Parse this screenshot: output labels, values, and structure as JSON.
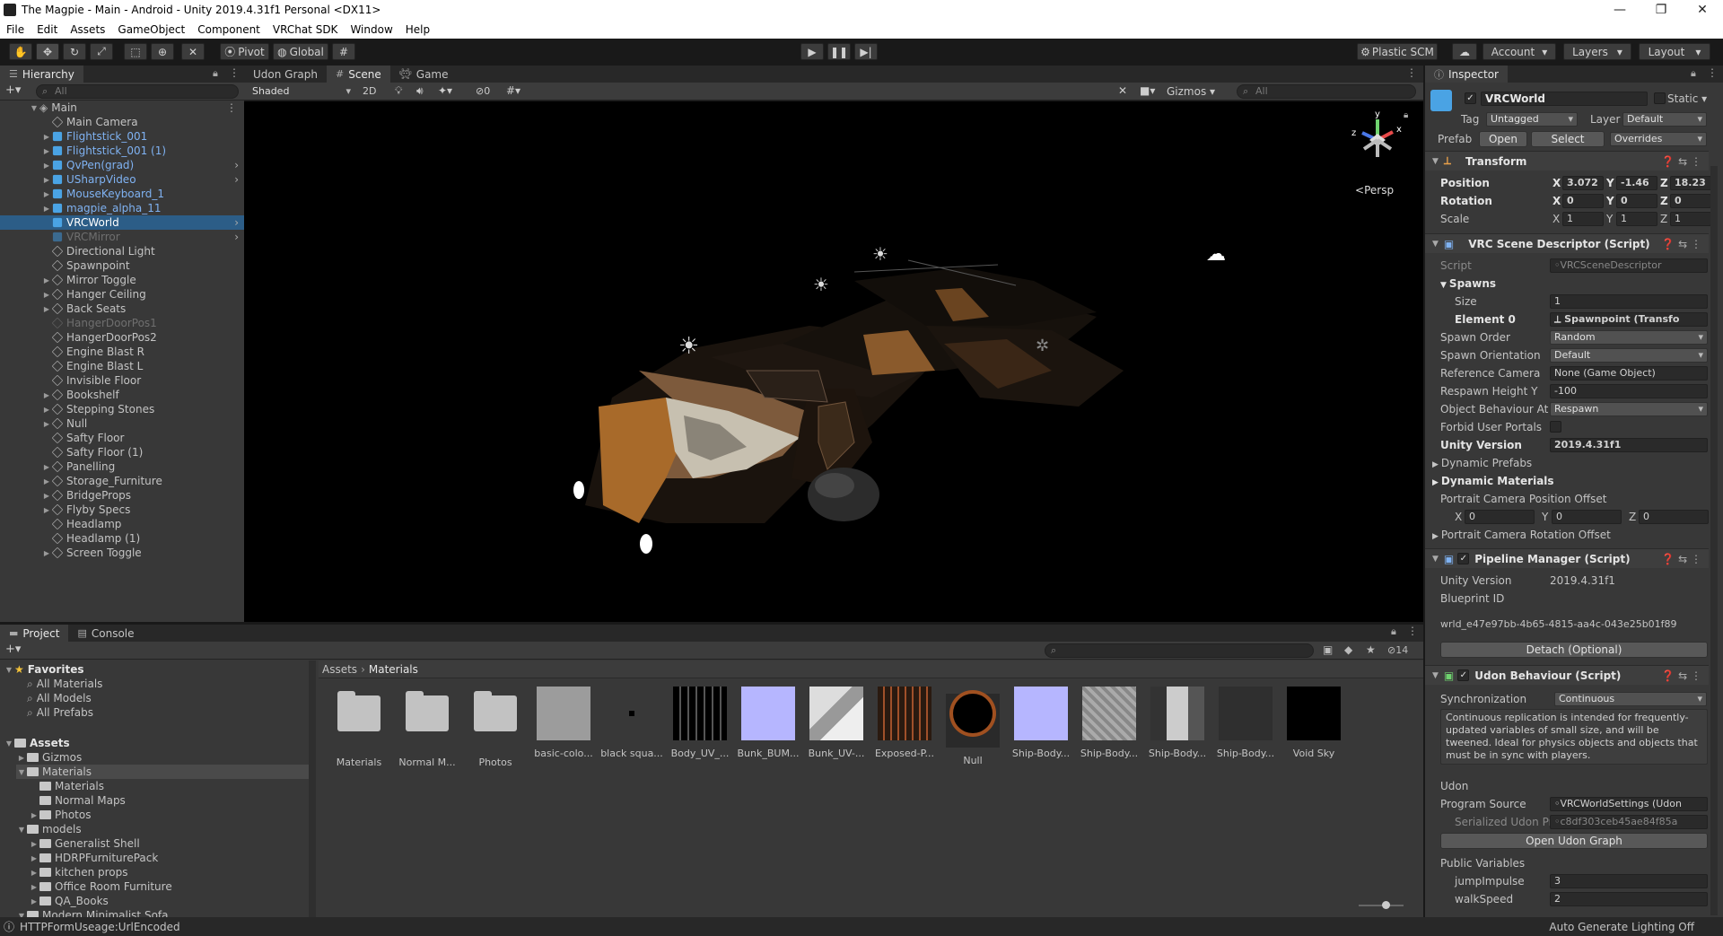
{
  "window": {
    "title": "The Magpie - Main - Android - Unity 2019.4.31f1 Personal <DX11>"
  },
  "menu": [
    "File",
    "Edit",
    "Assets",
    "GameObject",
    "Component",
    "VRChat SDK",
    "Window",
    "Help"
  ],
  "toolbar": {
    "pivot": "Pivot",
    "global": "Global",
    "plastic": "Plastic SCM",
    "account": "Account",
    "layers": "Layers",
    "layout": "Layout"
  },
  "hierarchy": {
    "tab": "Hierarchy",
    "search_placeholder": "All",
    "scene": "Main",
    "items": [
      {
        "label": "Main Camera",
        "type": "go",
        "arrow": false
      },
      {
        "label": "Flightstick_001",
        "type": "prefab",
        "arrow": true
      },
      {
        "label": "Flightstick_001 (1)",
        "type": "prefab",
        "arrow": true
      },
      {
        "label": "QvPen(grad)",
        "type": "prefab",
        "arrow": true,
        "more": true
      },
      {
        "label": "USharpVideo",
        "type": "prefab",
        "arrow": true,
        "more": true
      },
      {
        "label": "MouseKeyboard_1",
        "type": "prefab",
        "arrow": true
      },
      {
        "label": "magpie_alpha_11",
        "type": "prefab",
        "arrow": true
      },
      {
        "label": "VRCWorld",
        "type": "prefab",
        "arrow": false,
        "selected": true,
        "more": true
      },
      {
        "label": "VRCMirror",
        "type": "inactive-prefab",
        "arrow": false,
        "more": true
      },
      {
        "label": "Directional Light",
        "type": "go",
        "arrow": false
      },
      {
        "label": "Spawnpoint",
        "type": "go",
        "arrow": false
      },
      {
        "label": "Mirror Toggle",
        "type": "go",
        "arrow": true
      },
      {
        "label": "Hanger Ceiling",
        "type": "go",
        "arrow": true
      },
      {
        "label": "Back Seats",
        "type": "go",
        "arrow": true
      },
      {
        "label": "HangerDoorPos1",
        "type": "inactive",
        "arrow": false
      },
      {
        "label": "HangerDoorPos2",
        "type": "go",
        "arrow": false
      },
      {
        "label": "Engine Blast R",
        "type": "go",
        "arrow": false
      },
      {
        "label": "Engine Blast L",
        "type": "go",
        "arrow": false
      },
      {
        "label": "Invisible Floor",
        "type": "go",
        "arrow": false
      },
      {
        "label": "Bookshelf",
        "type": "go",
        "arrow": true
      },
      {
        "label": "Stepping Stones",
        "type": "go",
        "arrow": true
      },
      {
        "label": "Null",
        "type": "go",
        "arrow": true
      },
      {
        "label": "Safty Floor",
        "type": "go",
        "arrow": false
      },
      {
        "label": "Safty Floor (1)",
        "type": "go",
        "arrow": false
      },
      {
        "label": "Panelling",
        "type": "go",
        "arrow": true
      },
      {
        "label": "Storage_Furniture",
        "type": "go",
        "arrow": true
      },
      {
        "label": "BridgeProps",
        "type": "go",
        "arrow": true
      },
      {
        "label": "Flyby Specs",
        "type": "go",
        "arrow": true
      },
      {
        "label": "Headlamp",
        "type": "go",
        "arrow": false
      },
      {
        "label": "Headlamp (1)",
        "type": "go",
        "arrow": false
      },
      {
        "label": "Screen Toggle",
        "type": "go",
        "arrow": true
      }
    ]
  },
  "scene_view": {
    "tabs": [
      "Udon Graph",
      "Scene",
      "Game"
    ],
    "shading": "Shaded",
    "mode_2d": "2D",
    "hidden_count": "0",
    "gizmos": "Gizmos",
    "search_placeholder": "All",
    "persp": "Persp",
    "axes": {
      "x": "x",
      "y": "y",
      "z": "z"
    }
  },
  "inspector": {
    "tab": "Inspector",
    "object_name": "VRCWorld",
    "static": "Static",
    "tag_label": "Tag",
    "tag": "Untagged",
    "layer_label": "Layer",
    "layer": "Default",
    "prefab_label": "Prefab",
    "prefab_open": "Open",
    "prefab_select": "Select",
    "prefab_overrides": "Overrides",
    "transform": {
      "title": "Transform",
      "position_label": "Position",
      "pos": [
        "3.072",
        "-1.46",
        "18.23"
      ],
      "rotation_label": "Rotation",
      "rot": [
        "0",
        "0",
        "0"
      ],
      "scale_label": "Scale",
      "scale": [
        "1",
        "1",
        "1"
      ]
    },
    "descriptor": {
      "title": "VRC Scene Descriptor (Script)",
      "script_label": "Script",
      "script": "VRCSceneDescriptor",
      "spawns": "Spawns",
      "size_label": "Size",
      "size": "1",
      "element0_label": "Element 0",
      "element0": "Spawnpoint (Transfo",
      "spawn_order_label": "Spawn Order",
      "spawn_order": "Random",
      "spawn_orient_label": "Spawn Orientation",
      "spawn_orient": "Default",
      "ref_camera_label": "Reference Camera",
      "ref_camera": "None (Game Object)",
      "respawn_label": "Respawn Height Y",
      "respawn": "-100",
      "obj_behaviour_label": "Object Behaviour At F",
      "obj_behaviour": "Respawn",
      "forbid_label": "Forbid User Portals",
      "unity_version_label": "Unity Version",
      "unity_version": "2019.4.31f1",
      "dyn_prefabs": "Dynamic Prefabs",
      "dyn_materials": "Dynamic Materials",
      "portrait_pos": "Portrait Camera Position Offset",
      "portrait_xyz": [
        "0",
        "0",
        "0"
      ],
      "portrait_rot": "Portrait Camera Rotation Offset"
    },
    "pipeline": {
      "title": "Pipeline Manager (Script)",
      "unity_version_label": "Unity Version",
      "unity_version": "2019.4.31f1",
      "blueprint_label": "Blueprint ID",
      "blueprint": "wrld_e47e97bb-4b65-4815-aa4c-043e25b01f89",
      "detach": "Detach (Optional)"
    },
    "udon": {
      "title": "Udon Behaviour (Script)",
      "sync_label": "Synchronization",
      "sync": "Continuous",
      "help": "Continuous replication is intended for frequently-updated variables of small size, and will be tweened. Ideal for physics objects and objects that must be in sync with players.",
      "udon_label": "Udon",
      "program_label": "Program Source",
      "program": "VRCWorldSettings (Udon",
      "serialized_label": "Serialized Udon Pr",
      "serialized": "c8df303ceb45ae84f85a",
      "open_graph": "Open Udon Graph",
      "public_vars": "Public Variables",
      "jump_label": "jumpImpulse",
      "jump": "3",
      "walk_label": "walkSpeed",
      "walk": "2"
    }
  },
  "project": {
    "tabs": [
      "Project",
      "Console"
    ],
    "hidden_count": "14",
    "breadcrumb": [
      "Assets",
      "Materials"
    ],
    "favorites": "Favorites",
    "fav_items": [
      "All Materials",
      "All Models",
      "All Prefabs"
    ],
    "tree": [
      {
        "label": "Assets",
        "depth": 0,
        "bold": true
      },
      {
        "label": "Gizmos",
        "depth": 1
      },
      {
        "label": "Materials",
        "depth": 1,
        "sel": true
      },
      {
        "label": "Materials",
        "depth": 2
      },
      {
        "label": "Normal Maps",
        "depth": 2
      },
      {
        "label": "Photos",
        "depth": 2
      },
      {
        "label": "models",
        "depth": 1
      },
      {
        "label": "Generalist Shell",
        "depth": 2
      },
      {
        "label": "HDRPFurniturePack",
        "depth": 2
      },
      {
        "label": "kitchen props",
        "depth": 2
      },
      {
        "label": "Office Room Furniture",
        "depth": 2
      },
      {
        "label": "QA_Books",
        "depth": 2
      },
      {
        "label": "Modern Minimalist Sofa",
        "depth": 1
      }
    ],
    "assets": [
      {
        "label": "Materials",
        "kind": "folder"
      },
      {
        "label": "Normal M...",
        "kind": "folder"
      },
      {
        "label": "Photos",
        "kind": "folder"
      },
      {
        "label": "basic-colo...",
        "kind": "grey"
      },
      {
        "label": "black squa...",
        "kind": "dot"
      },
      {
        "label": "Body_UV_...",
        "kind": "uv"
      },
      {
        "label": "Bunk_BUM...",
        "kind": "lav"
      },
      {
        "label": "Bunk_UV-...",
        "kind": "uvlight"
      },
      {
        "label": "Exposed-P...",
        "kind": "exposed"
      },
      {
        "label": "Null",
        "kind": "null"
      },
      {
        "label": "Ship-Body...",
        "kind": "lav"
      },
      {
        "label": "Ship-Body...",
        "kind": "greytex"
      },
      {
        "label": "Ship-Body...",
        "kind": "greytex2"
      },
      {
        "label": "Ship-Body...",
        "kind": "darkfig"
      },
      {
        "label": "Void Sky",
        "kind": "black"
      }
    ]
  },
  "status": {
    "left": "HTTPFormUseage:UrlEncoded",
    "right": "Auto Generate Lighting Off"
  }
}
